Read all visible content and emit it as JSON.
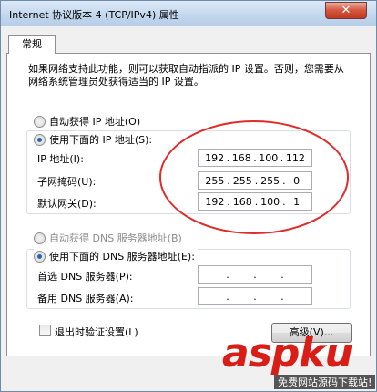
{
  "window": {
    "title": "Internet 协议版本 4 (TCP/IPv4) 属性",
    "close_glyph": "✕"
  },
  "tab": {
    "label": "常规"
  },
  "description": "如果网络支持此功能，则可以获取自动指派的 IP 设置。否则，您需要从网络系统管理员处获得适当的 IP 设置。",
  "ip": {
    "auto_label": "自动获得 IP 地址(O)",
    "manual_label": "使用下面的 IP 地址(S):",
    "selected": "manual",
    "address_label": "IP 地址(I):",
    "address": [
      "192",
      "168",
      "100",
      "112"
    ],
    "subnet_label": "子网掩码(U):",
    "subnet": [
      "255",
      "255",
      "255",
      "0"
    ],
    "gateway_label": "默认网关(D):",
    "gateway": [
      "192",
      "168",
      "100",
      "1"
    ]
  },
  "dns": {
    "auto_label": "自动获得 DNS 服务器地址(B)",
    "manual_label": "使用下面的 DNS 服务器地址(E):",
    "selected": "manual",
    "preferred_label": "首选 DNS 服务器(P):",
    "alternate_label": "备用 DNS 服务器(A):"
  },
  "validate_on_exit_label": "退出时验证设置(L)",
  "advanced_button": "高级(V)...",
  "watermark": {
    "text": "aspku",
    "sub": "免费网站源码下载站!"
  },
  "annotation_color": "#e02b2b"
}
